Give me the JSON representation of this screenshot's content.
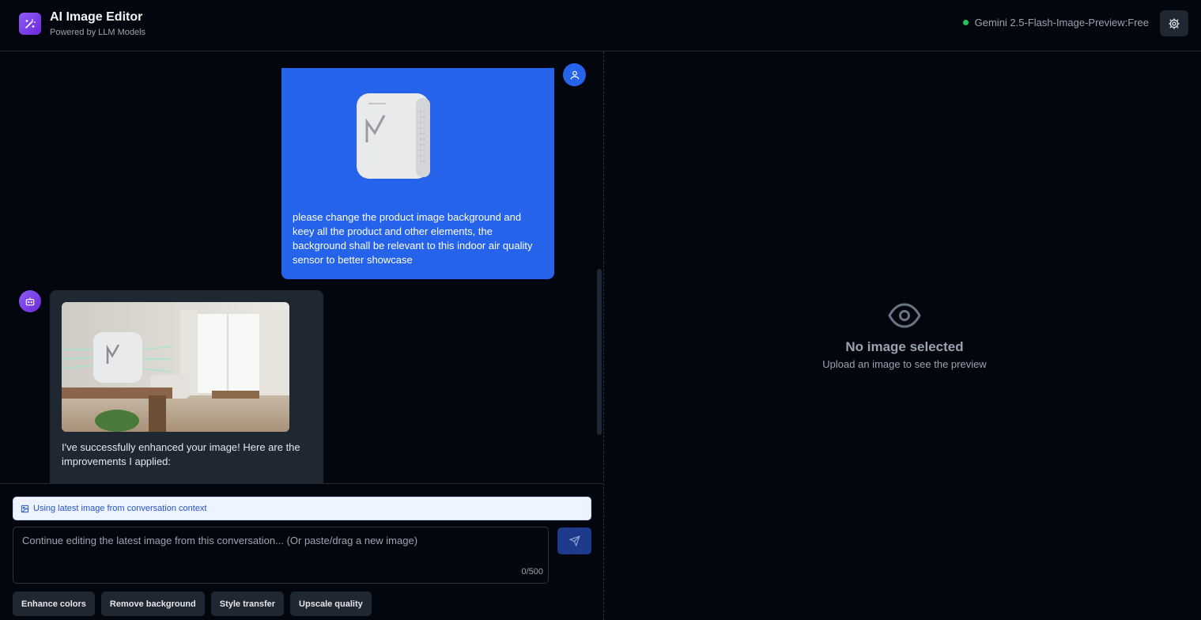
{
  "header": {
    "title": "AI Image Editor",
    "subtitle": "Powered by LLM Models",
    "model_name": "Gemini 2.5-Flash-Image-Preview:Free",
    "status_color": "#22c55e",
    "logo_icon": "magic-wand-icon",
    "settings_icon": "gear-icon"
  },
  "chat": {
    "messages": [
      {
        "role": "user",
        "image_icon": "product-photo-air-sensor",
        "text": "please change the product image background and keey all the product and other elements, the background shall be relevant to this indoor air quality sensor to better showcase"
      },
      {
        "role": "assistant",
        "image_icon": "edited-photo-living-room",
        "text": "I've successfully enhanced your image! Here are the improvements I applied:"
      }
    ]
  },
  "composer": {
    "context_banner": "Using latest image from conversation context",
    "placeholder": "Continue editing the latest image from this conversation... (Or paste/drag a new image)",
    "value": "",
    "counter": "0/500",
    "send_icon": "send-icon",
    "suggestions": [
      "Enhance colors",
      "Remove background",
      "Style transfer",
      "Upscale quality"
    ]
  },
  "preview": {
    "icon": "eye-icon",
    "title": "No image selected",
    "subtitle": "Upload an image to see the preview"
  },
  "colors": {
    "background": "#03060f",
    "user_bubble": "#2563eb",
    "assistant_bubble": "#1f2733",
    "accent_purple": "#7c3aed"
  }
}
